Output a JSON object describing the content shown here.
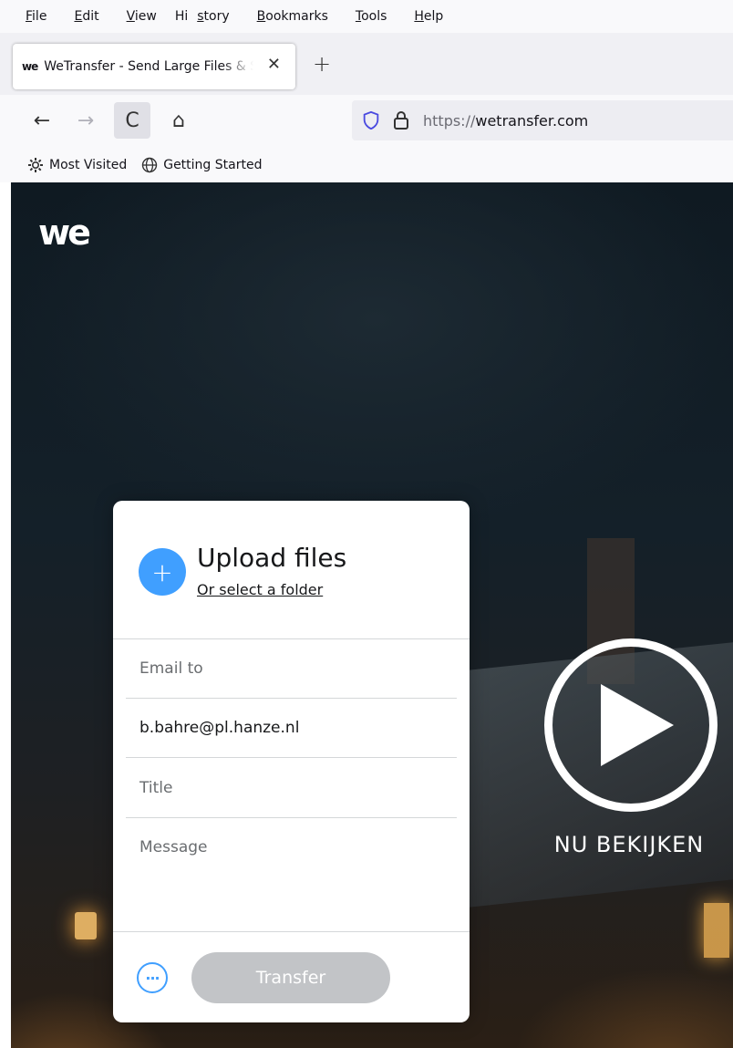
{
  "menu": {
    "items": [
      {
        "pre": "",
        "key": "F",
        "post": "ile"
      },
      {
        "pre": "",
        "key": "E",
        "post": "dit"
      },
      {
        "pre": "",
        "key": "V",
        "post": "iew"
      },
      {
        "pre": "Hi",
        "key": "s",
        "post": "tory"
      },
      {
        "pre": "",
        "key": "B",
        "post": "ookmarks"
      },
      {
        "pre": "",
        "key": "T",
        "post": "ools"
      },
      {
        "pre": "",
        "key": "H",
        "post": "elp"
      }
    ]
  },
  "tab": {
    "favicon": "we",
    "title": "WeTransfer - Send Large Files & Share Photos Online",
    "close": "✕"
  },
  "newtab": "+",
  "nav": {
    "back": "←",
    "forward": "→",
    "reload": "C",
    "home": "⌂",
    "url_proto": "https://",
    "url_host": "wetransfer.com"
  },
  "bookmarks": {
    "most_visited": "Most Visited",
    "getting_started": "Getting Started"
  },
  "page": {
    "logo": "we",
    "watch_label": "NU BEKIJKEN"
  },
  "upload": {
    "plus": "+",
    "title": "Upload files",
    "folder_link": "Or select a folder",
    "email_to_placeholder": "Email to",
    "email_value": "b.bahre@pl.hanze.nl",
    "title_placeholder": "Title",
    "message_placeholder": "Message",
    "more": "···",
    "transfer_label": "Transfer"
  },
  "colors": {
    "accent": "#409fff",
    "transfer_disabled": "#c2c4c7"
  },
  "icons": [
    "shield-icon",
    "lock-icon",
    "gear-icon",
    "globe-icon",
    "play-icon"
  ]
}
